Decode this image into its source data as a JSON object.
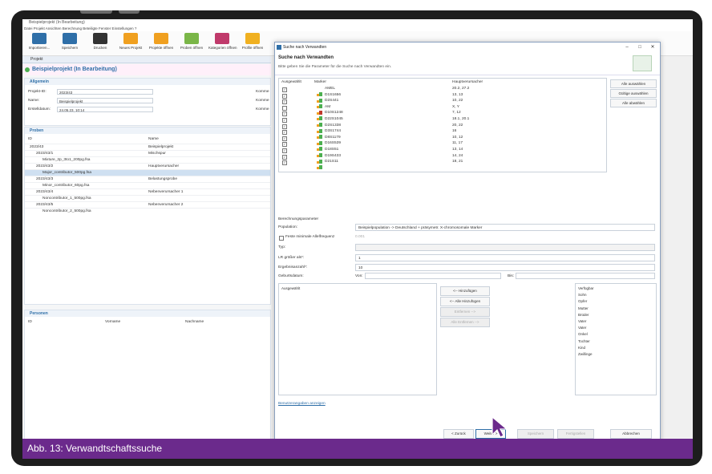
{
  "window": {
    "title": "Beispielprojekt (In Bearbeitung)",
    "menu": "Datei  Projekt  Ansichten  Berechnung  Beteiligte  Fenster  Einstellungen  ?"
  },
  "toolbar": {
    "items": [
      {
        "label": "Importieren...",
        "icon": "import-icon",
        "color": "#2f6fa8"
      },
      {
        "label": "Speichern",
        "icon": "save-icon",
        "color": "#2f6fa8"
      },
      {
        "label": "Drucken",
        "icon": "print-icon",
        "color": "#333333"
      },
      {
        "label": "Neues Projekt",
        "icon": "new-project-icon",
        "color": "#f0a020"
      },
      {
        "label": "Projekte öffnen",
        "icon": "open-folder-icon",
        "color": "#f0a020"
      },
      {
        "label": "Proben öffnen",
        "icon": "samples-icon",
        "color": "#7ab648"
      },
      {
        "label": "Kategorien öffnen",
        "icon": "categories-icon",
        "color": "#c03a6b"
      },
      {
        "label": "Profile öffnen",
        "icon": "profiles-icon",
        "color": "#f0b020"
      }
    ]
  },
  "project": {
    "tab": "Projekt",
    "header": "Beispielprojekt (In Bearbeitung)",
    "general": {
      "section": "Allgemein",
      "id_label": "Projekt-ID:",
      "id_value": "2023/43",
      "name_label": "Name:",
      "name_value": "Beispielprojekt",
      "created_label": "Erstelldatum:",
      "created_value": "24.05.23, 10:14",
      "comment_label": "Komme"
    },
    "samples": {
      "section": "Proben",
      "col_id": "ID",
      "col_name": "Name",
      "rows": [
        {
          "id": "2023/43",
          "name": "Beispielprojekt",
          "indent": 0,
          "selected": false
        },
        {
          "id": "2023/43/1",
          "name": "Mischspur",
          "indent": 1,
          "selected": false
        },
        {
          "id": "Mixture_2p_3to1_200pg.fsa",
          "name": "",
          "indent": 2,
          "selected": false
        },
        {
          "id": "2023/43/2",
          "name": "Hauptverursacher",
          "indent": 1,
          "selected": false
        },
        {
          "id": "Major_contributor_500pg.fsa",
          "name": "",
          "indent": 2,
          "selected": true
        },
        {
          "id": "2023/43/3",
          "name": "Belastungsprobe",
          "indent": 1,
          "selected": false
        },
        {
          "id": "Minor_contributor_60pg.fsa",
          "name": "",
          "indent": 2,
          "selected": false
        },
        {
          "id": "2023/43/4",
          "name": "Nebenverursacher 1",
          "indent": 1,
          "selected": false
        },
        {
          "id": "Noncontributor_1_500pg.fsa",
          "name": "",
          "indent": 2,
          "selected": false
        },
        {
          "id": "2023/43/5",
          "name": "Nebenverursacher 2",
          "indent": 1,
          "selected": false
        },
        {
          "id": "Noncontributor_2_500pg.fsa",
          "name": "",
          "indent": 2,
          "selected": false
        }
      ]
    },
    "persons": {
      "section": "Personen",
      "col_id": "ID",
      "col_first": "Vorname",
      "col_last": "Nachname"
    }
  },
  "dialog": {
    "title": "Suche nach Verwandten",
    "heading": "Suche nach Verwandten",
    "subheading": "Bitte geben Sie die Parameter für die Suche nach Verwandten ein.",
    "col_selected": "Ausgewählt",
    "col_marker": "Marker",
    "col_main": "Hauptverursacher",
    "markers": [
      {
        "name": "AMEL",
        "value": "20.2, 27.2",
        "checked": true
      },
      {
        "name": "D1S1656",
        "value": "13, 13",
        "checked": true
      },
      {
        "name": "D2S441",
        "value": "10, 22",
        "checked": true
      },
      {
        "name": "AM",
        "value": "X, Y",
        "checked": false
      },
      {
        "name": "D10S1248",
        "value": "7, 12",
        "checked": true
      },
      {
        "name": "D22S1045",
        "value": "18.1, 20.1",
        "checked": true
      },
      {
        "name": "D2S1338",
        "value": "20, 22",
        "checked": true
      },
      {
        "name": "D3S1744",
        "value": "16",
        "checked": true
      },
      {
        "name": "D8S1179",
        "value": "10, 12",
        "checked": true
      },
      {
        "name": "D16S539",
        "value": "11, 17",
        "checked": true
      },
      {
        "name": "D18S51",
        "value": "13, 14",
        "checked": true
      },
      {
        "name": "D19S433",
        "value": "14, 24",
        "checked": true
      },
      {
        "name": "D21S11",
        "value": "18, 21",
        "checked": true
      }
    ],
    "side_buttons": [
      "Alle auswählen",
      "Gültige auswählen",
      "Alle abwählen"
    ],
    "params": {
      "section": "Berechnungsparameter",
      "population_label": "Population:",
      "population_value": "Beispielpopulation -> Deutschland + präsymetr. X-chromosomale Marker",
      "min_freq_label": "Feste minimale Allelfrequenz",
      "min_freq_value": "0.001",
      "type_label": "Typ:",
      "type_value": "",
      "lr_label": "LR größer als*:",
      "lr_value": "1",
      "max_results_label": "Ergebnisanzahl*:",
      "max_results_value": "10",
      "age_label": "Geburtsdatum:",
      "from_label": "Von:",
      "to_label": "Bis:"
    },
    "selected_box_label": "Ausgewählt",
    "move_buttons": [
      {
        "label": "<-- Hinzufügen",
        "enabled": true
      },
      {
        "label": "<-- Alle Hinzufügen",
        "enabled": true
      },
      {
        "label": "Entfernen -->",
        "enabled": false
      },
      {
        "label": "Alle Entfernen -->",
        "enabled": false
      }
    ],
    "available": [
      "Verfügbar",
      "Sohn",
      "Opfer",
      "Mutter",
      "Brüder",
      "Vater",
      "Vater",
      "Onkel",
      "Tochter",
      "Kind",
      "Zwillinge"
    ],
    "link": "Benutzerangaben anzeigen",
    "footer": {
      "back": "< Zurück",
      "next": "Weiter >",
      "cancel_disabled": "Speichern",
      "finish": "Fertigstellen",
      "abort": "Abbrechen"
    }
  },
  "caption": "Abb. 13: Verwandtschaftssuche"
}
